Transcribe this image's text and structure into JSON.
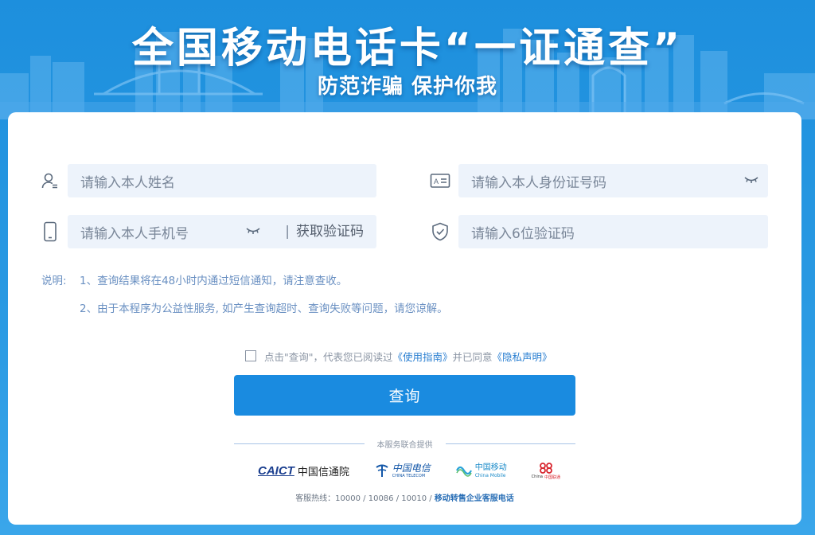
{
  "banner": {
    "title": "全国移动电话卡“一证通查”",
    "subtitle": "防范诈骗 保护你我"
  },
  "form": {
    "name_field": {
      "icon": "user-icon",
      "placeholder": "请输入本人姓名"
    },
    "id_field": {
      "icon": "id-card-icon",
      "placeholder": "请输入本人身份证号码",
      "toggle_icon": "eye-closed-icon"
    },
    "phone_field": {
      "icon": "mobile-phone-icon",
      "placeholder": "请输入本人手机号",
      "toggle_icon": "eye-closed-icon",
      "separator": "|",
      "get_code_label": "获取验证码"
    },
    "code_field": {
      "icon": "shield-check-icon",
      "placeholder": "请输入6位验证码"
    }
  },
  "notes": {
    "label": "说明:",
    "items": [
      "1、查询结果将在48小时内通过短信通知，请注意查收。",
      "2、由于本程序为公益性服务, 如产生查询超时、查询失败等问题，请您谅解。"
    ]
  },
  "agreement": {
    "prefix": "点击\"查询\"，代表您已阅读过",
    "guide_link": "《使用指南》",
    "middle": "并已同意",
    "privacy_link": "《隐私声明》"
  },
  "query_button": "查询",
  "joint_service_label": "本服务联合提供",
  "partners": [
    {
      "name": "caict-logo",
      "text": "CAICT",
      "text_cn": "中国信通院"
    },
    {
      "name": "china-telecom-logo",
      "text": "中国电信",
      "text_en": "CHINA TELECOM"
    },
    {
      "name": "china-mobile-logo",
      "text": "中国移动",
      "text_en": "China Mobile"
    },
    {
      "name": "china-unicom-logo",
      "text": "China",
      "text_cn": "中国联通"
    }
  ],
  "hotline": {
    "label": "客服热线：10000 / 10086 / 10010 / ",
    "strong": "移动转售企业客服电话"
  },
  "colors": {
    "background": "#1d8fdd",
    "card": "#ffffff",
    "input_bg": "#edf3fb",
    "primary_button": "#1a8be0",
    "note_text": "#6a90c2",
    "link": "#2a7fd1"
  }
}
